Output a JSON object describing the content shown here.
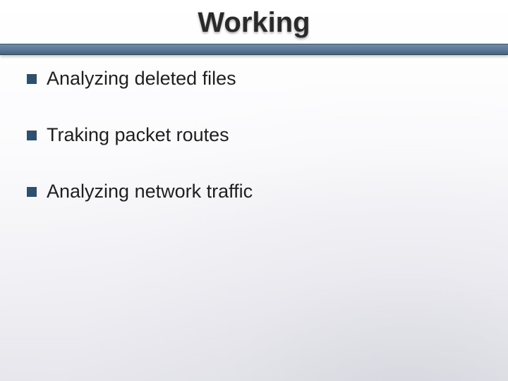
{
  "slide": {
    "title": "Working",
    "bullets": [
      "Analyzing deleted files",
      "Traking packet routes",
      "Analyzing network traffic"
    ]
  }
}
